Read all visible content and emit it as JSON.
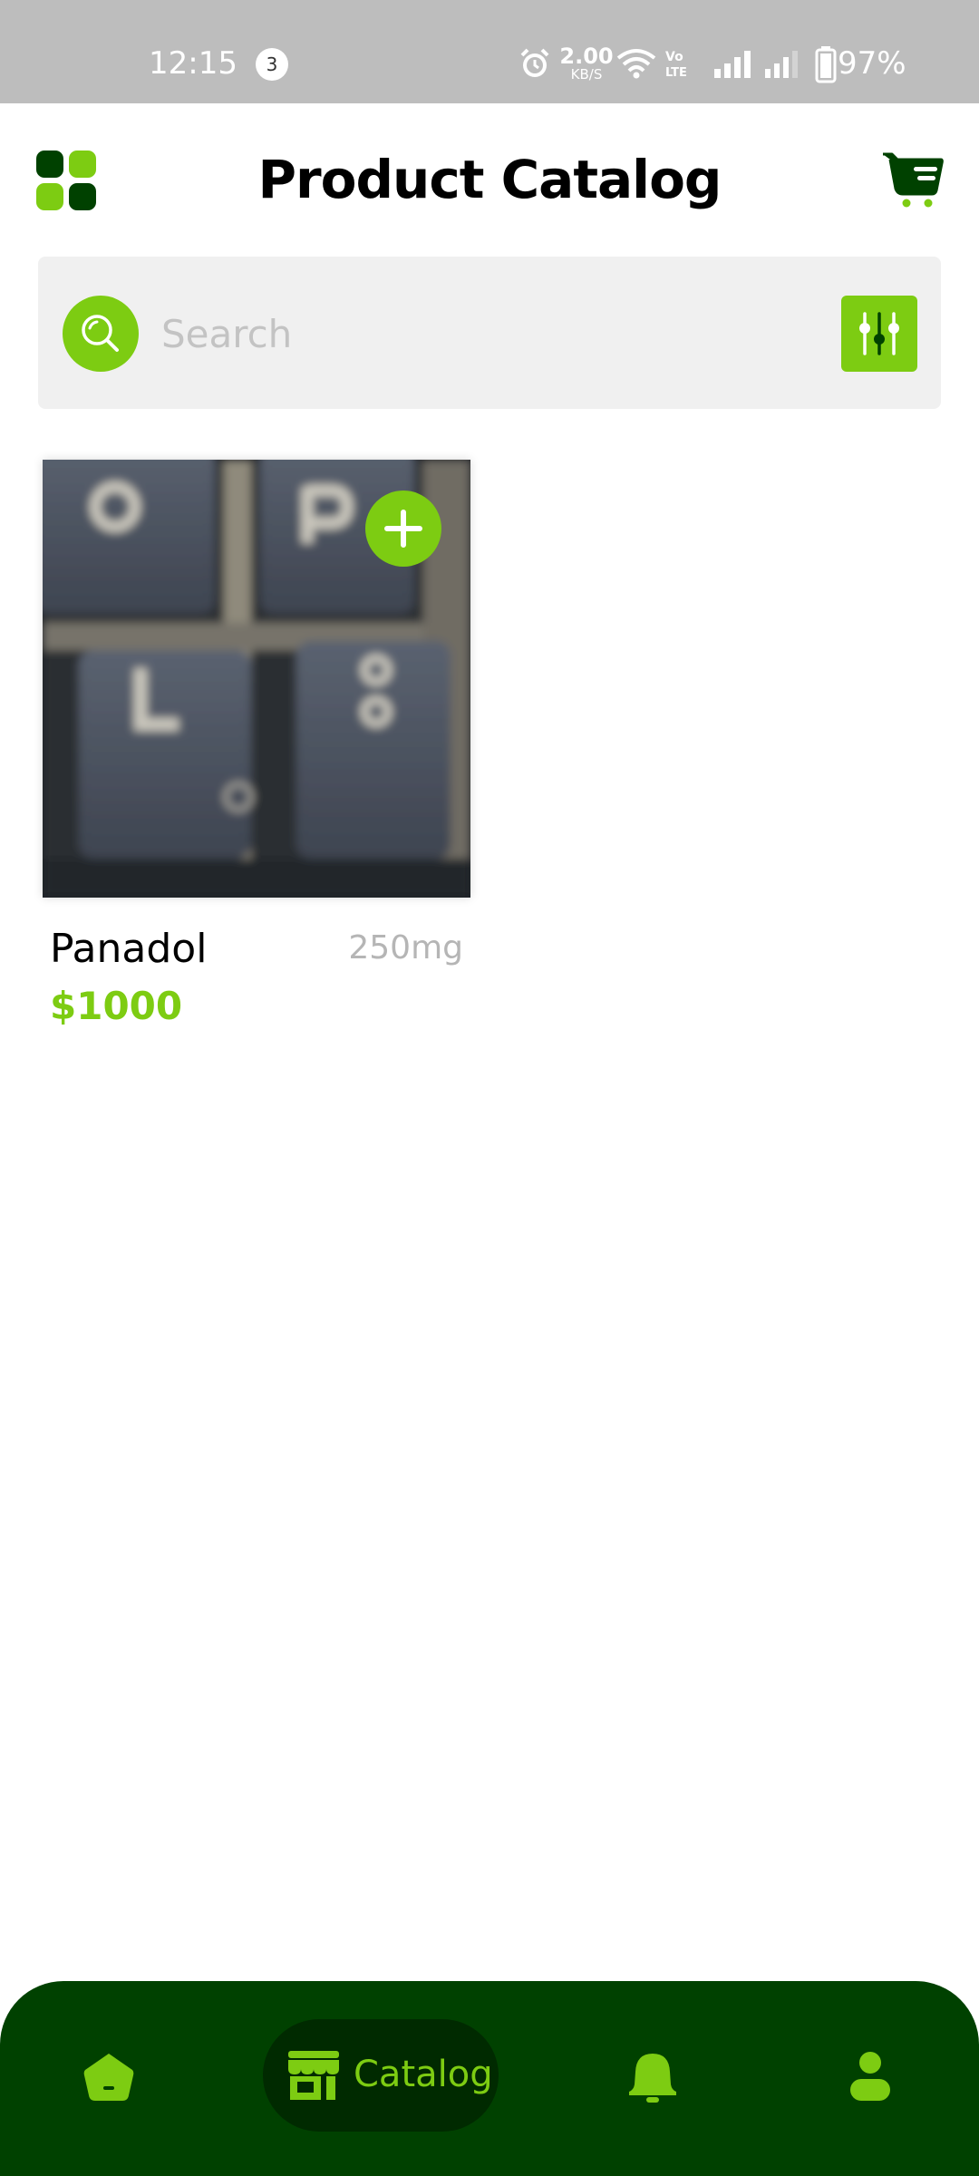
{
  "status_bar": {
    "time": "12:15",
    "notification_count": "3",
    "net_speed_value": "2.00",
    "net_speed_unit": "KB/S",
    "volte_label": "Vo LTE",
    "battery_percent": "97%"
  },
  "header": {
    "title": "Product Catalog",
    "menu_icon": "grid-menu-icon",
    "cart_icon": "cart-icon"
  },
  "search": {
    "placeholder": "Search",
    "value": "",
    "search_icon": "search-icon",
    "filter_icon": "filter-sliders-icon"
  },
  "products": [
    {
      "name": "Panadol",
      "dose": "250mg",
      "price": "$1000",
      "image": "keyboard-keys-photo",
      "add_icon": "plus-icon"
    }
  ],
  "bottom_nav": {
    "items": [
      {
        "id": "home",
        "icon": "home-icon",
        "label": ""
      },
      {
        "id": "catalog",
        "icon": "store-icon",
        "label": "Catalog",
        "active": true
      },
      {
        "id": "notifications",
        "icon": "bell-icon",
        "label": ""
      },
      {
        "id": "profile",
        "icon": "person-icon",
        "label": ""
      }
    ]
  },
  "colors": {
    "accent_green": "#7dcc12",
    "dark_green": "#004100",
    "darker_green": "#002a00",
    "status_bar_gray": "#bdbdbd",
    "search_bg": "#f0f0f0"
  }
}
